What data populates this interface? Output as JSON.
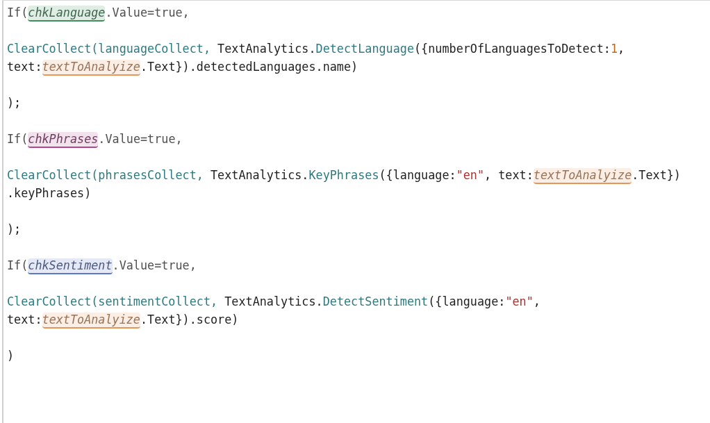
{
  "blocks": [
    {
      "lines": [
        {
          "tokens": [
            {
              "text": "If(",
              "kind": "keyword"
            },
            {
              "text": "chkLanguage",
              "kind": "reference",
              "color": "#3d8f5c"
            },
            {
              "text": ".Value=true,",
              "kind": "keyword"
            }
          ]
        }
      ]
    },
    {
      "lines": [
        {
          "tokens": [
            {
              "text": "ClearCollect(languageCollect,",
              "kind": "function"
            },
            {
              "text": " TextAnalytics.",
              "kind": "plain"
            },
            {
              "text": "DetectLanguage",
              "kind": "function"
            },
            {
              "text": "({numberOfLanguagesToDetect:",
              "kind": "plain"
            },
            {
              "text": "1",
              "kind": "number"
            },
            {
              "text": ",",
              "kind": "plain"
            }
          ]
        },
        {
          "tokens": [
            {
              "text": "text:",
              "kind": "plain"
            },
            {
              "text": "textToAnalyize",
              "kind": "reference",
              "color": "#e8955a"
            },
            {
              "text": ".Text}).detectedLanguages.name)",
              "kind": "plain"
            }
          ]
        }
      ]
    },
    {
      "lines": [
        {
          "tokens": [
            {
              "text": ");",
              "kind": "plain"
            }
          ]
        }
      ]
    },
    {
      "lines": [
        {
          "tokens": [
            {
              "text": "If(",
              "kind": "keyword"
            },
            {
              "text": "chkPhrases",
              "kind": "reference",
              "color": "#b0488f"
            },
            {
              "text": ".Value=true,",
              "kind": "keyword"
            }
          ]
        }
      ]
    },
    {
      "lines": [
        {
          "tokens": [
            {
              "text": "ClearCollect(phrasesCollect,",
              "kind": "function"
            },
            {
              "text": " TextAnalytics.",
              "kind": "plain"
            },
            {
              "text": "KeyPhrases",
              "kind": "function"
            },
            {
              "text": "({language:",
              "kind": "plain"
            },
            {
              "text": "\"en\"",
              "kind": "string"
            },
            {
              "text": ", text:",
              "kind": "plain"
            },
            {
              "text": "textToAnalyize",
              "kind": "reference",
              "color": "#e8955a"
            },
            {
              "text": ".Text})",
              "kind": "plain"
            }
          ]
        },
        {
          "tokens": [
            {
              "text": ".keyPhrases)",
              "kind": "plain"
            }
          ]
        }
      ]
    },
    {
      "lines": [
        {
          "tokens": [
            {
              "text": ");",
              "kind": "plain"
            }
          ]
        }
      ]
    },
    {
      "lines": [
        {
          "tokens": [
            {
              "text": "If(",
              "kind": "keyword"
            },
            {
              "text": "chkSentiment",
              "kind": "reference",
              "color": "#5a78c8"
            },
            {
              "text": ".Value=true,",
              "kind": "keyword"
            }
          ]
        }
      ]
    },
    {
      "lines": [
        {
          "tokens": [
            {
              "text": "ClearCollect(sentimentCollect,",
              "kind": "function"
            },
            {
              "text": " TextAnalytics.",
              "kind": "plain"
            },
            {
              "text": "DetectSentiment",
              "kind": "function"
            },
            {
              "text": "({language:",
              "kind": "plain"
            },
            {
              "text": "\"en\"",
              "kind": "string"
            },
            {
              "text": ",",
              "kind": "plain"
            }
          ]
        },
        {
          "tokens": [
            {
              "text": "text:",
              "kind": "plain"
            },
            {
              "text": "textToAnalyize",
              "kind": "reference",
              "color": "#e8955a"
            },
            {
              "text": ".Text}).score)",
              "kind": "plain"
            }
          ]
        }
      ]
    },
    {
      "lines": [
        {
          "tokens": [
            {
              "text": ")",
              "kind": "plain"
            }
          ]
        }
      ]
    }
  ]
}
